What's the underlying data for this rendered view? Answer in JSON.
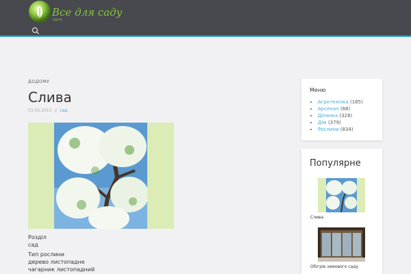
{
  "site": {
    "title": "Все для саду",
    "tagline": "Ідуть"
  },
  "breadcrumb": "Додому",
  "post": {
    "title": "Слива",
    "date": "03.05.2015",
    "separator": "//",
    "category": "сад"
  },
  "details": {
    "section_label": "Розділ",
    "section_value": "сад",
    "type_label": "Тип рослини",
    "type_values": [
      "дерево листопадне",
      "чагарник листопадний"
    ]
  },
  "menu_widget": {
    "title": "Меню",
    "items": [
      {
        "label": "Агротехніка",
        "count": "(185)"
      },
      {
        "label": "Арсенал",
        "count": "(68)"
      },
      {
        "label": "Ділянка",
        "count": "(328)"
      },
      {
        "label": "Дім",
        "count": "(379)"
      },
      {
        "label": "Рослини",
        "count": "(834)"
      }
    ]
  },
  "popular_widget": {
    "title": "Популярне",
    "items": [
      {
        "caption": "Слива"
      },
      {
        "caption": "Обігрів зимового саду"
      }
    ]
  },
  "colors": {
    "header_bg": "#47494f",
    "accent": "#3fa9d6",
    "logo_green": "#8cc63f"
  },
  "icons": {
    "search": "search-icon",
    "logo": "logo-icon"
  }
}
